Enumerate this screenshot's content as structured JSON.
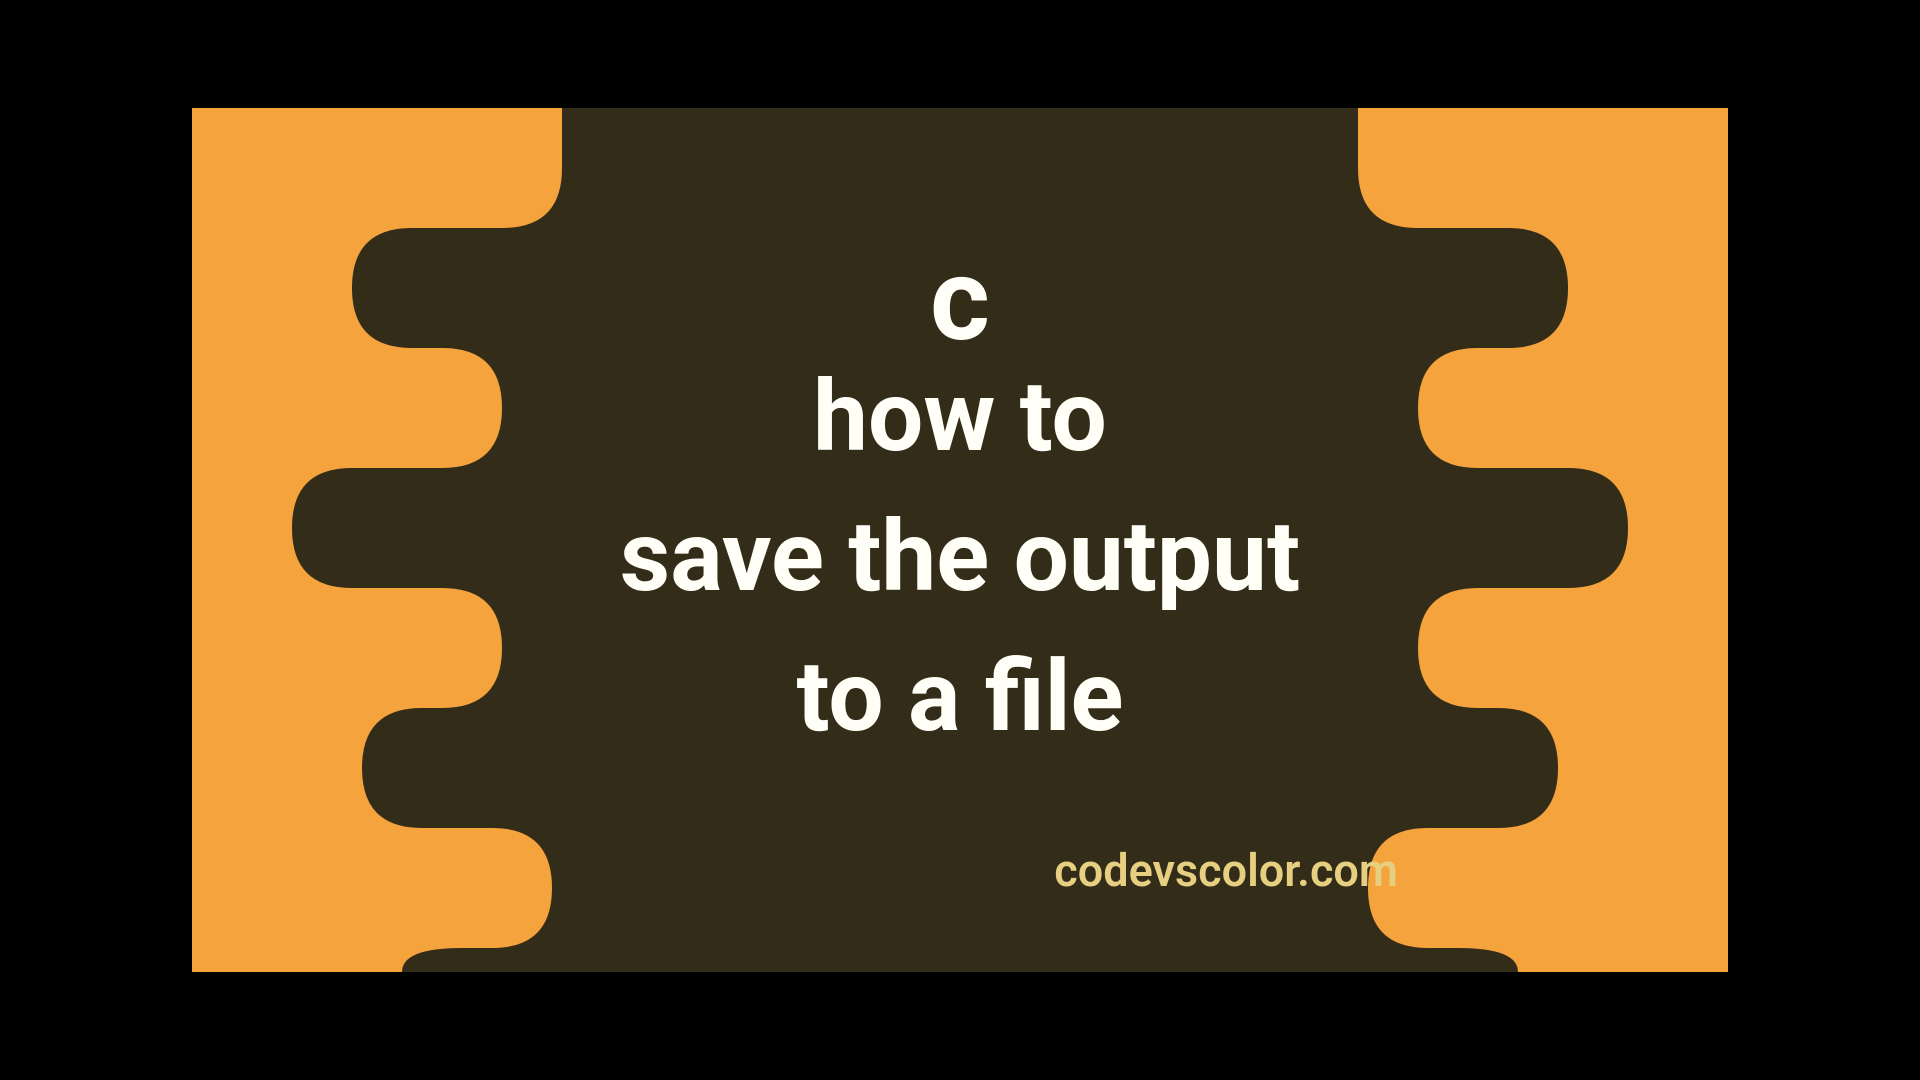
{
  "colors": {
    "background_orange": "#f5a33c",
    "blob_dark": "#332c19",
    "text_primary": "#fffef7",
    "text_accent": "#e6cf80"
  },
  "title": {
    "line1": "c",
    "line2": "how to",
    "line3": "save the output",
    "line4": "to a file"
  },
  "site": "codevscolor.com"
}
